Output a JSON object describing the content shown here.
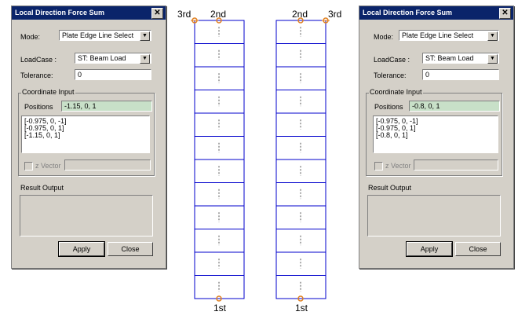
{
  "left_dialog": {
    "title": "Local Direction Force Sum",
    "mode_label": "Mode:",
    "mode_value": "Plate Edge Line Select",
    "loadcase_label": "LoadCase :",
    "loadcase_value": "ST: Beam Load",
    "tolerance_label": "Tolerance:",
    "tolerance_value": "0",
    "coord_group_title": "Coordinate Input",
    "positions_label": "Positions",
    "positions_value": "-1.15, 0, 1",
    "list_items": [
      "[-0.975, 0, -1]",
      "[-0.975, 0, 1]",
      "[-1.15, 0, 1]"
    ],
    "zvector_label": "z Vector",
    "result_label": "Result Output",
    "apply_label": "Apply",
    "close_label": "Close"
  },
  "right_dialog": {
    "title": "Local Direction Force Sum",
    "mode_label": "Mode:",
    "mode_value": "Plate Edge Line Select",
    "loadcase_label": "LoadCase :",
    "loadcase_value": "ST: Beam Load",
    "tolerance_label": "Tolerance:",
    "tolerance_value": "0",
    "coord_group_title": "Coordinate Input",
    "positions_label": "Positions",
    "positions_value": "-0.8, 0, 1",
    "list_items": [
      "[-0.975, 0, -1]",
      "[-0.975, 0, 1]",
      "[-0.8, 0, 1]"
    ],
    "zvector_label": "z Vector",
    "result_label": "Result Output",
    "apply_label": "Apply",
    "close_label": "Close"
  },
  "left_plate": {
    "label_3rd": "3rd",
    "label_2nd": "2nd",
    "label_1st": "1st",
    "rows": 12
  },
  "right_plate": {
    "label_3rd": "3rd",
    "label_2nd": "2nd",
    "label_1st": "1st",
    "rows": 12
  },
  "colors": {
    "grid": "#0000cc",
    "node": "#e08020",
    "dialog_bg": "#d4d0c8",
    "title_bg": "#0a246a",
    "positions_bg": "#c8e0c8"
  }
}
